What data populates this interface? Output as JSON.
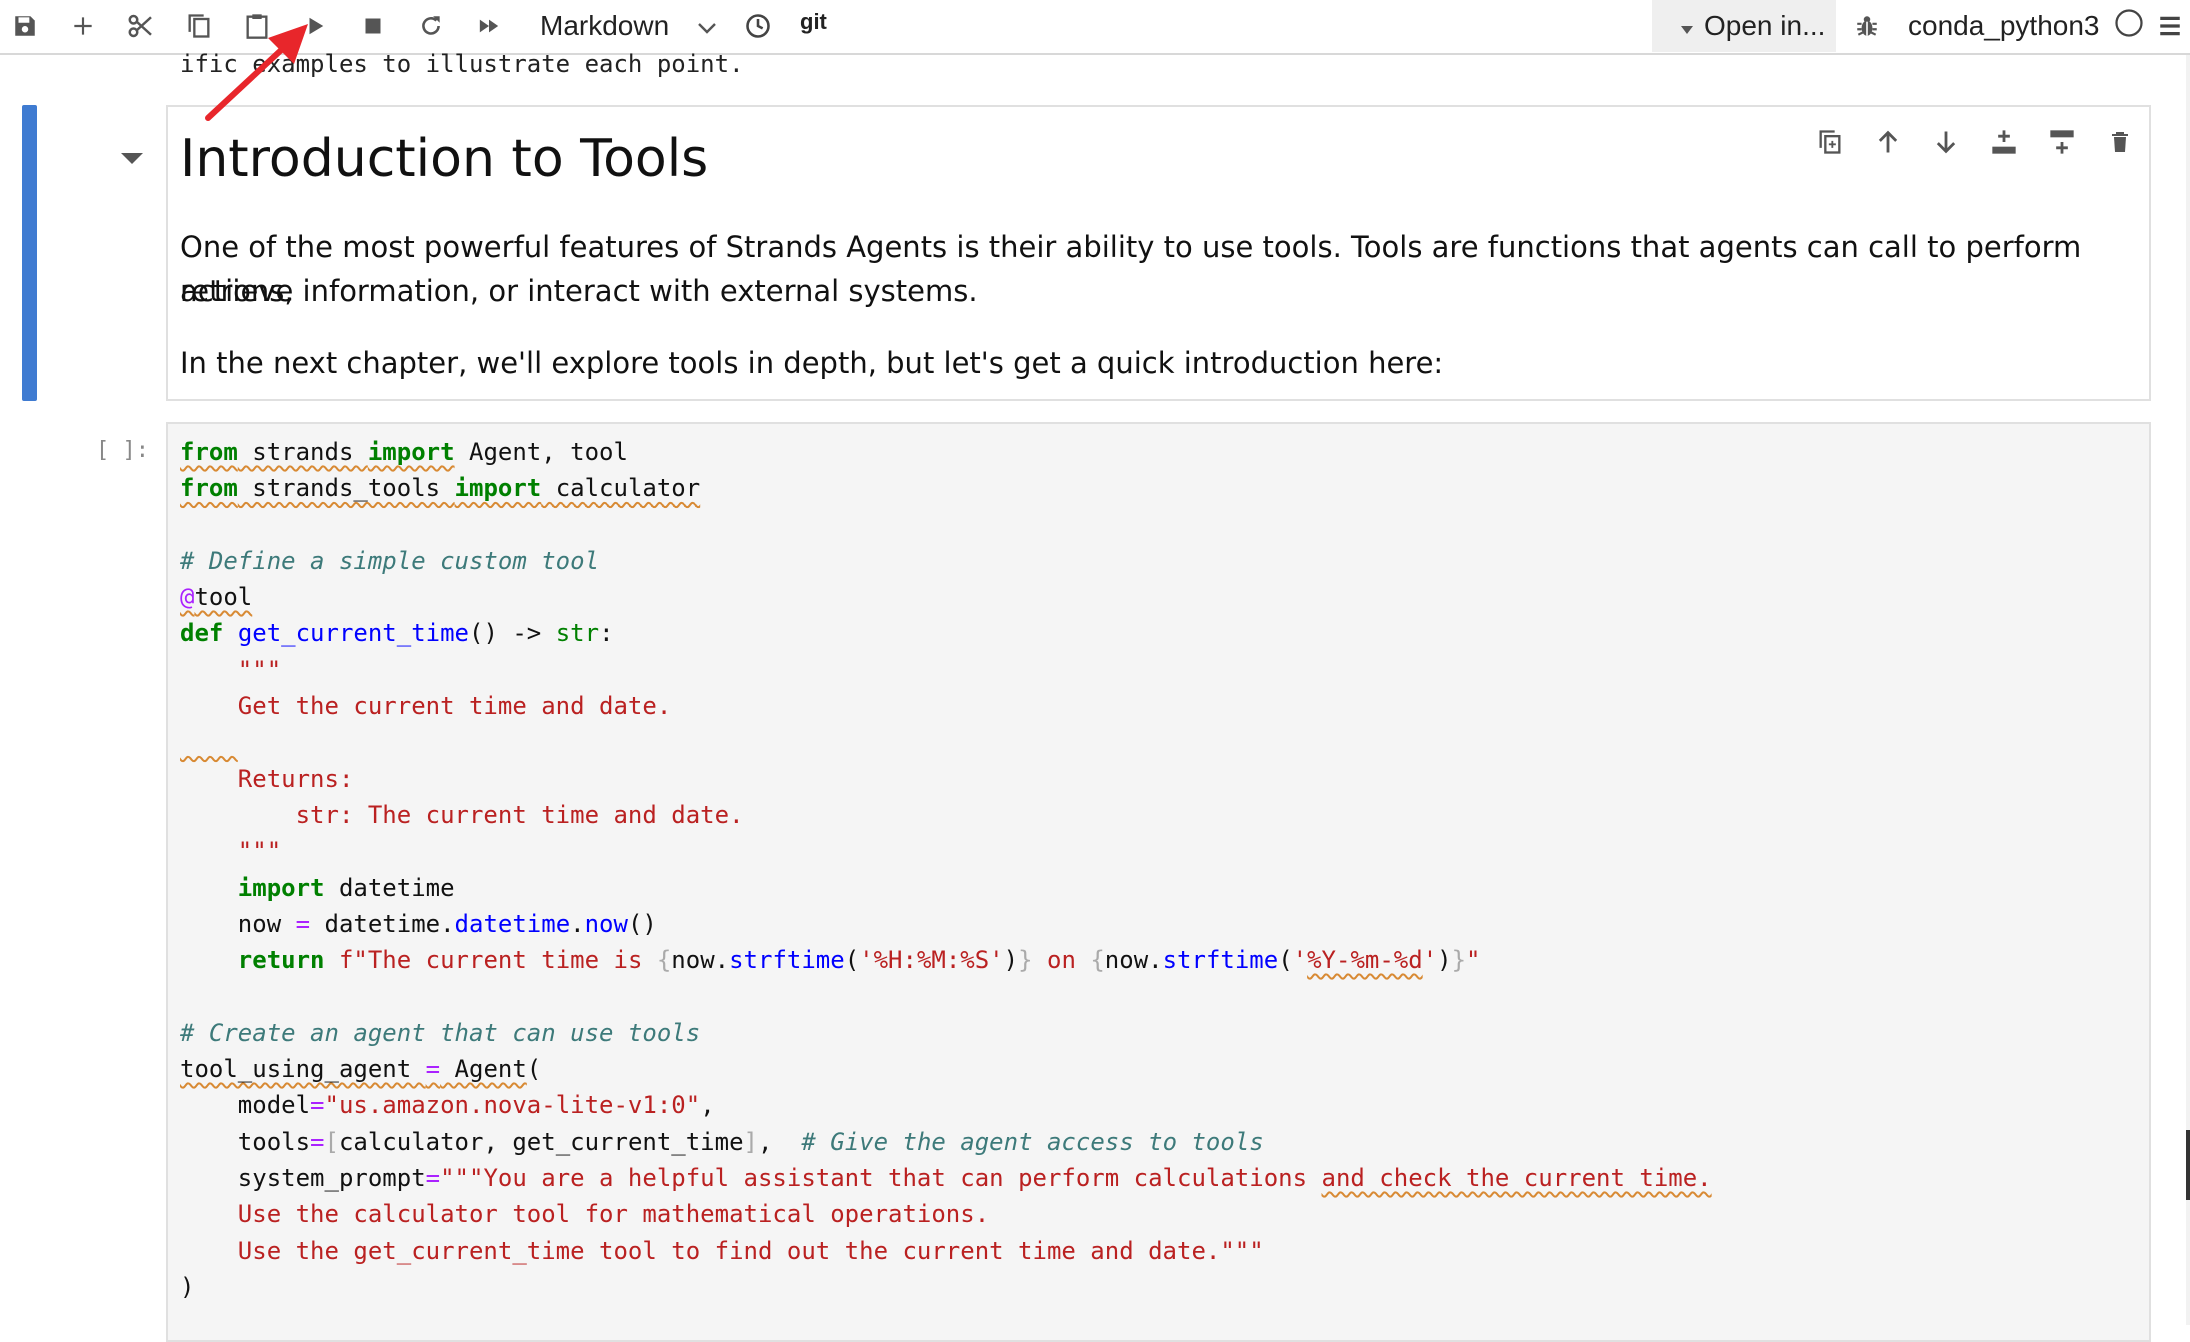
{
  "toolbar": {
    "buttons": [
      "save-icon",
      "add-icon",
      "cut-icon",
      "copy-icon",
      "paste-icon",
      "run-icon",
      "stop-icon",
      "restart-icon",
      "fast-forward-icon"
    ],
    "cell_type": "Markdown",
    "git_label": "git",
    "open_in_label": "Open in...",
    "kernel_name": "conda_python3"
  },
  "prev_text": "ific examples to illustrate each point.",
  "markdown_cell": {
    "title": "Introduction to Tools",
    "paragraph1_line1": "One of the most powerful features of Strands Agents is their ability to use tools. Tools are functions that agents can call to perform actions,",
    "paragraph1_line2": "retrieve information, or interact with external systems.",
    "paragraph2": "In the next chapter, we'll explore tools in depth, but let's get a quick introduction here:"
  },
  "code_cell": {
    "prompt": "[ ]:",
    "lines": [
      "from strands import Agent, tool",
      "from strands_tools import calculator",
      "",
      "# Define a simple custom tool",
      "@tool",
      "def get_current_time() -> str:",
      "    \"\"\"",
      "    Get the current time and date.",
      "",
      "    Returns:",
      "        str: The current time and date.",
      "    \"\"\"",
      "    import datetime",
      "    now = datetime.datetime.now()",
      "    return f\"The current time is {now.strftime('%H:%M:%S')} on {now.strftime('%Y-%m-%d')}\"",
      "",
      "# Create an agent that can use tools",
      "tool_using_agent = Agent(",
      "    model=\"us.amazon.nova-lite-v1:0\",",
      "    tools=[calculator, get_current_time],  # Give the agent access to tools",
      "    system_prompt=\"\"\"You are a helpful assistant that can perform calculations and check the current time.",
      "    Use the calculator tool for mathematical operations.",
      "    Use the get_current_time tool to find out the current time and date.\"\"\"",
      ")"
    ]
  },
  "colors": {
    "active_cell_bar": "#3f7bd1",
    "keyword": "#008000",
    "string": "#ba2121",
    "comment": "#3d7a7a",
    "function": "#0000ff",
    "annotation_arrow": "#e8262b"
  }
}
